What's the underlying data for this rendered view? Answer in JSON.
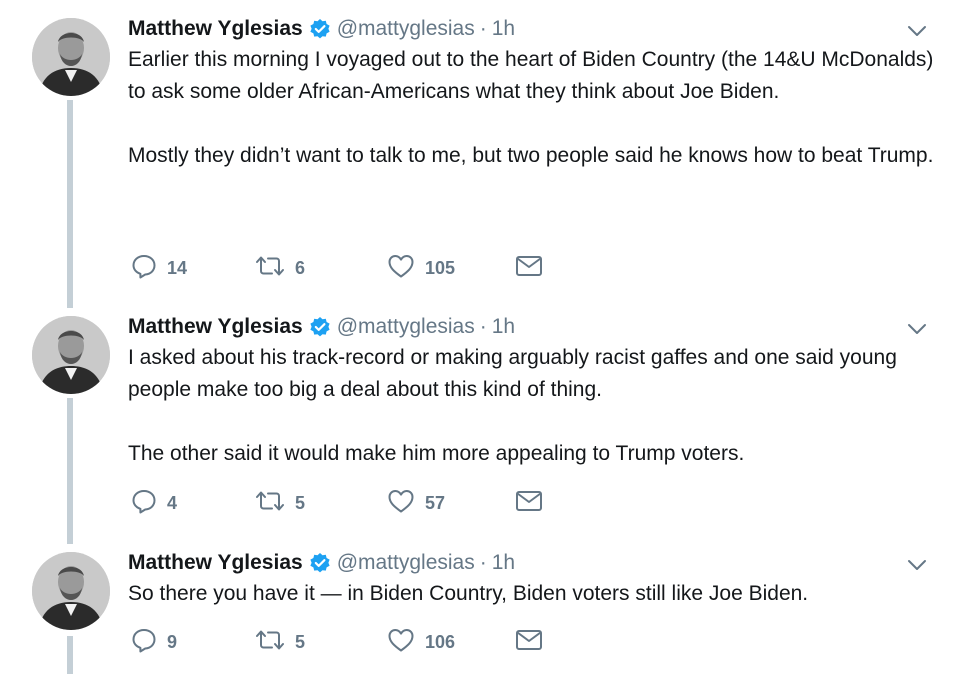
{
  "author": {
    "name": "Matthew Yglesias",
    "handle": "@mattyglesias",
    "separator": "·"
  },
  "colors": {
    "text": "#14171a",
    "muted": "#657786",
    "verified": "#1da1f2",
    "thread_line": "#c4cfd6"
  },
  "icons": [
    "verified-badge-icon",
    "chevron-down-icon",
    "reply-icon",
    "retweet-icon",
    "like-icon",
    "direct-message-icon"
  ],
  "tweets": [
    {
      "time": "1h",
      "paragraphs": [
        "Earlier this morning I voyaged out to the heart of Biden Country (the 14&U McDonalds) to ask some older African-Americans what they think about Joe Biden.",
        "Mostly they didn’t want to talk to me, but two people said he knows how to beat Trump."
      ],
      "replies": "14",
      "retweets": "6",
      "likes": "105"
    },
    {
      "time": "1h",
      "paragraphs": [
        "I asked about his track-record or making arguably racist gaffes and one said young people make too big a deal about this kind of thing.",
        "The other said it would make him more appealing to Trump voters."
      ],
      "replies": "4",
      "retweets": "5",
      "likes": "57"
    },
    {
      "time": "1h",
      "paragraphs": [
        "So there you have it — in Biden Country, Biden voters still like Joe Biden."
      ],
      "replies": "9",
      "retweets": "5",
      "likes": "106"
    }
  ]
}
